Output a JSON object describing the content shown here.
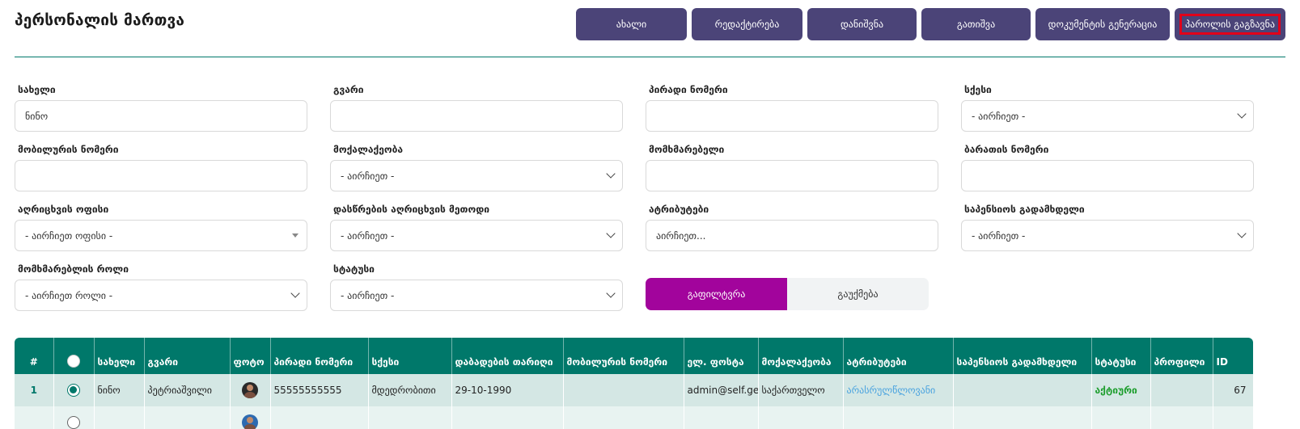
{
  "page": {
    "title": "პერსონალის მართვა"
  },
  "toolbar": {
    "new": "ახალი",
    "edit": "რედაქტირება",
    "appoint": "დანიშვნა",
    "dismiss": "გათიშვა",
    "generate_document": "დოკუმენტის გენერაცია",
    "send_password": "პაროლის გაგზავნა"
  },
  "filters": {
    "name": {
      "label": "სახელი",
      "value": "ნინო"
    },
    "surname": {
      "label": "გვარი",
      "value": ""
    },
    "personal_number": {
      "label": "პირადი ნომერი",
      "value": ""
    },
    "gender": {
      "label": "სქესი",
      "value": "- აირჩიეთ -"
    },
    "mobile": {
      "label": "მობილურის ნომერი",
      "value": ""
    },
    "citizenship": {
      "label": "მოქალაქეობა",
      "value": "- აირჩიეთ -"
    },
    "user": {
      "label": "მომხმარებელი",
      "value": ""
    },
    "card_number": {
      "label": "ბარათის ნომერი",
      "value": ""
    },
    "registration_office": {
      "label": "აღრიცხვის ოფისი",
      "value": "- აირჩიეთ ოფისი -"
    },
    "attendance_method": {
      "label": "დასწრების აღრიცხვის მეთოდი",
      "value": "- აირჩიეთ -"
    },
    "attributes": {
      "label": "ატრიბუტები",
      "value": "აირჩიეთ..."
    },
    "pension_payer": {
      "label": "საპენსიოს გადამხდელი",
      "value": "- აირჩიეთ -"
    },
    "user_role": {
      "label": "მომხმარებლის როლი",
      "value": "- აირჩიეთ როლი -"
    },
    "status": {
      "label": "სტატუსი",
      "value": "- აირჩიეთ -"
    }
  },
  "actions": {
    "filter": "გაფილტვრა",
    "cancel": "გაუქმება"
  },
  "table": {
    "headers": {
      "index": "#",
      "name": "სახელი",
      "surname": "გვარი",
      "photo": "ფოტო",
      "personal_number": "პირადი ნომერი",
      "gender": "სქესი",
      "birth_date": "დაბადების თარიღი",
      "mobile": "მობილურის ნომერი",
      "email": "ელ. ფოსტა",
      "citizenship": "მოქალაქეობა",
      "attributes": "ატრიბუტები",
      "pension_payer": "საპენსიოს გადამხდელი",
      "status": "სტატუსი",
      "profile": "პროფილი",
      "id": "ID"
    },
    "rows": [
      {
        "index": "1",
        "name": "ნინო",
        "surname": "პეტრიაშვილი",
        "personal_number": "55555555555",
        "gender": "მდედრობითი",
        "birth_date": "29-10-1990",
        "mobile": "",
        "email": "admin@self.ge",
        "citizenship": "საქართველო",
        "attributes": "არასრულწლოვანი",
        "pension_payer": "",
        "status": "აქტიური",
        "profile": "",
        "id": "67",
        "selected": true
      }
    ]
  },
  "colors": {
    "primary": "#4b4478",
    "teal": "#00786a",
    "magenta": "#a2049c",
    "highlight": "#e2001a"
  }
}
